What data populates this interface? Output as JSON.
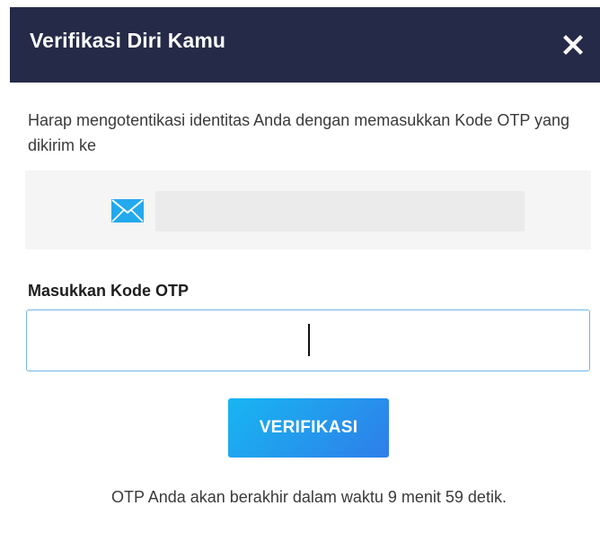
{
  "colors": {
    "header_bg": "#252a48",
    "accent_start": "#17b6f2",
    "accent_end": "#2f7ee9",
    "input_border": "#6fb6e6"
  },
  "header": {
    "title": "Verifikasi Diri Kamu",
    "close_icon": "close-icon"
  },
  "description": "Harap mengotentikasi identitas Anda dengan memasukkan Kode OTP yang dikirim ke",
  "recipient": {
    "icon": "mail-icon",
    "value": ""
  },
  "otp": {
    "label": "Masukkan Kode OTP",
    "value": "",
    "placeholder": ""
  },
  "verify_button": {
    "label": "VERIFIKASI"
  },
  "expiry_text": "OTP Anda akan berakhir dalam waktu 9 menit 59 detik."
}
